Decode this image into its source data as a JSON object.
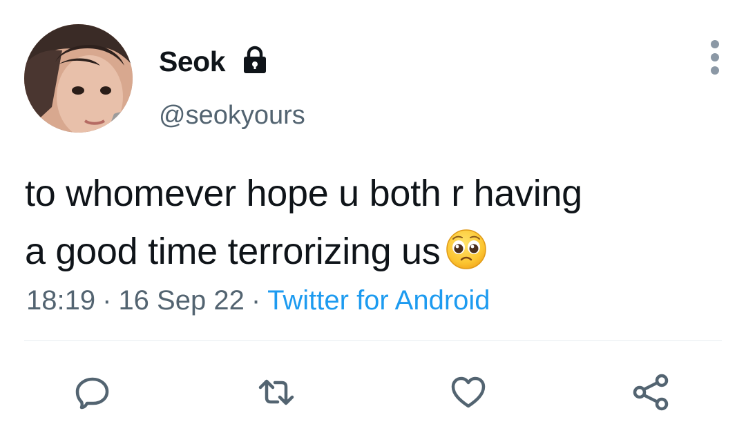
{
  "author": {
    "display_name": "Seok",
    "handle": "@seokyours",
    "protected_icon": "lock-icon",
    "avatar": "profile-photo"
  },
  "tweet": {
    "text_lines": [
      "to whomever hope u both r having",
      "a good time terrorizing us"
    ],
    "emoji": "pleading-face-emoji",
    "time": "18:19",
    "date": "16 Sep 22",
    "separator": "·",
    "source": "Twitter for Android"
  },
  "menu": {
    "icon": "more-vertical-icon"
  },
  "actions": [
    {
      "name": "reply",
      "icon": "reply-icon"
    },
    {
      "name": "retweet",
      "icon": "retweet-icon"
    },
    {
      "name": "like",
      "icon": "heart-icon"
    },
    {
      "name": "share",
      "icon": "share-icon"
    }
  ],
  "colors": {
    "text": "#0f1419",
    "secondary": "#536471",
    "link": "#1d9bf0",
    "divider": "#e6ecf0",
    "action_icon": "#536471"
  }
}
